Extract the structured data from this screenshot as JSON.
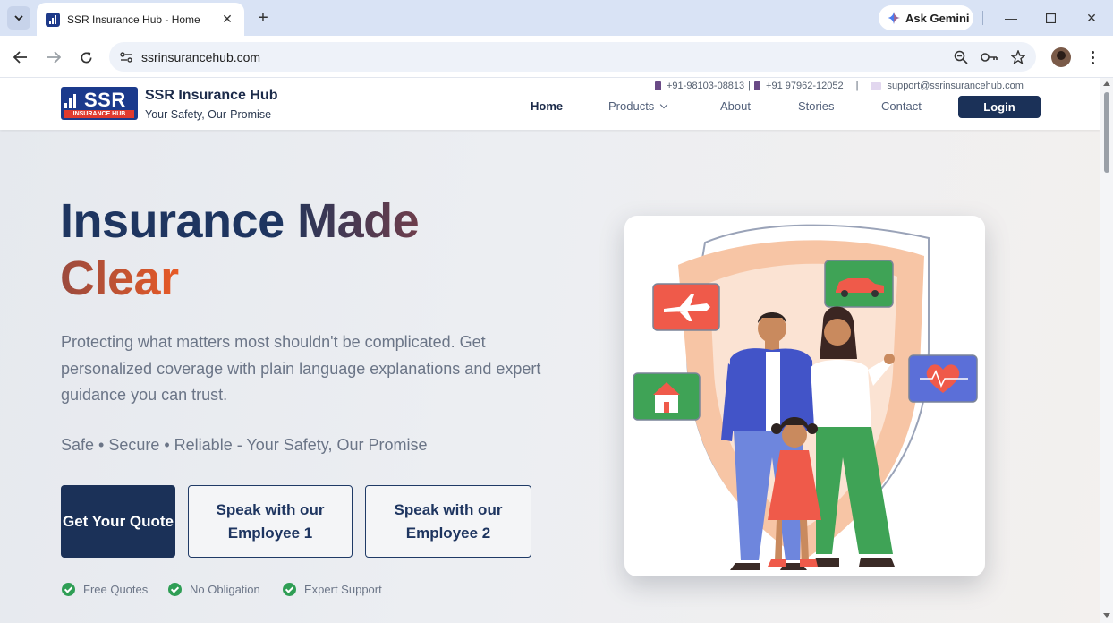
{
  "browser": {
    "tab_title": "SSR Insurance Hub - Home",
    "url": "ssrinsurancehub.com",
    "gemini_label": "Ask Gemini",
    "icons": [
      "tab-search-icon",
      "close-icon",
      "new-tab-icon",
      "gemini-icon",
      "minimize-icon",
      "maximize-icon",
      "close-window-icon",
      "back-icon",
      "forward-icon",
      "reload-icon",
      "site-info-icon",
      "zoom-icon",
      "password-key-icon",
      "bookmark-star-icon",
      "profile-avatar",
      "more-menu-icon"
    ]
  },
  "site": {
    "brand": {
      "logo_text": "SSR",
      "logo_strip": "INSURANCE HUB",
      "name": "SSR Insurance Hub",
      "tagline": "Your Safety, Our-Promise"
    },
    "contact": {
      "phone1": "+91-98103-08813",
      "phone2": "+91 97962-12052",
      "sep": "|",
      "email": "support@ssrinsurancehub.com"
    },
    "nav": {
      "home": "Home",
      "products": "Products",
      "about": "About",
      "stories": "Stories",
      "contact": "Contact",
      "login": "Login"
    }
  },
  "hero": {
    "headline_part1": "Insurance ",
    "headline_part2": "Made",
    "headline_part3": "Clear",
    "description": "Protecting what matters most shouldn't be complicated. Get personalized coverage with plain language explanations and expert guidance you can trust.",
    "tagline": "Safe • Secure • Reliable - Your Safety, Our Promise",
    "buttons": {
      "quote": "Get Your Quote",
      "employee1": "Speak with our Employee 1",
      "employee2": "Speak with our Employee 2"
    },
    "features": [
      "Free Quotes",
      "No Obligation",
      "Expert Support"
    ]
  },
  "colors": {
    "primary": "#1b3158",
    "accent_orange": "#e85a26",
    "check_green": "#2f9e55"
  }
}
